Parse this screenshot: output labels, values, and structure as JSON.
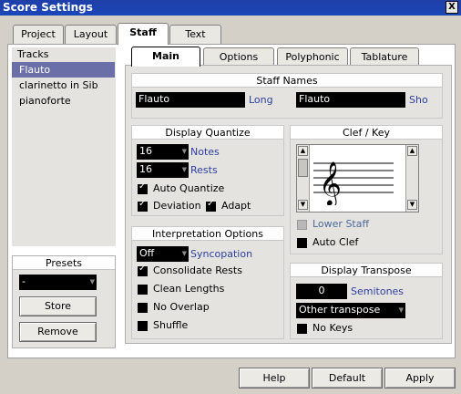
{
  "window": {
    "title": "Score Settings",
    "close_label": "X"
  },
  "top_tabs": {
    "project": "Project",
    "layout": "Layout",
    "staff": "Staff",
    "text": "Text"
  },
  "tracks": {
    "header": "Tracks",
    "items": [
      "Flauto",
      "clarinetto in Sib",
      "pianoforte"
    ]
  },
  "presets": {
    "header": "Presets",
    "value": "-",
    "store": "Store",
    "remove": "Remove"
  },
  "sub_tabs": {
    "main": "Main",
    "options": "Options",
    "polyphonic": "Polyphonic",
    "tablature": "Tablature"
  },
  "staff_names": {
    "header": "Staff Names",
    "long_value": "Flauto",
    "long_label": "Long",
    "short_value": "Flauto",
    "short_label": "Sho"
  },
  "display_quantize": {
    "header": "Display Quantize",
    "notes_value": "16",
    "notes_label": "Notes",
    "rests_value": "16",
    "rests_label": "Rests",
    "auto_quantize": "Auto Quantize",
    "deviation": "Deviation",
    "adapt": "Adapt"
  },
  "interpretation": {
    "header": "Interpretation Options",
    "sync_value": "Off",
    "sync_label": "Syncopation",
    "consolidate": "Consolidate Rests",
    "clean": "Clean Lengths",
    "no_overlap": "No Overlap",
    "shuffle": "Shuffle"
  },
  "clef_key": {
    "header": "Clef / Key",
    "lower_staff": "Lower Staff",
    "auto_clef": "Auto Clef"
  },
  "transpose": {
    "header": "Display Transpose",
    "semitones_value": "0",
    "semitones_label": "Semitones",
    "other_value": "Other transpose",
    "no_keys": "No Keys"
  },
  "buttons": {
    "help": "Help",
    "default": "Default",
    "apply": "Apply"
  }
}
